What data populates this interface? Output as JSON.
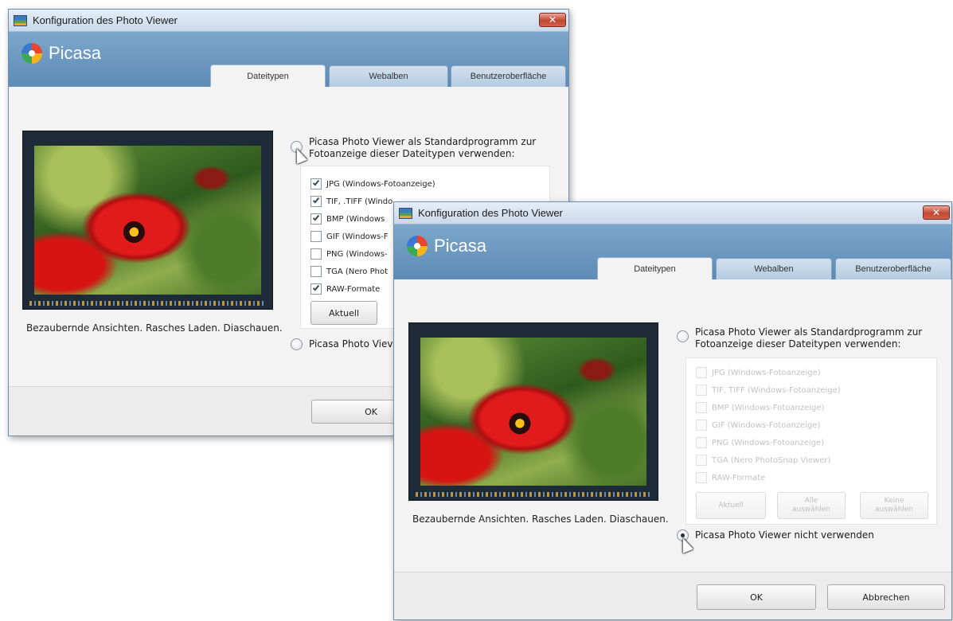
{
  "back_window": {
    "title": "Konfiguration des Photo Viewer",
    "close_glyph": "✕",
    "logo": "Picasa",
    "tabs": [
      "Dateitypen",
      "Webalben",
      "Benutzeroberfläche"
    ],
    "caption": "Bezaubernde Ansichten. Rasches Laden. Diaschauen.",
    "radio_default_line1": "Picasa Photo Viewer als Standardprogramm zur",
    "radio_default_line2": "Fotoanzeige dieser Dateitypen verwenden:",
    "file_types": [
      {
        "label": "JPG (Windows-Fotoanzeige)",
        "checked": true
      },
      {
        "label": "TIF, .TIFF (Windo",
        "checked": true
      },
      {
        "label": "BMP (Windows",
        "checked": true
      },
      {
        "label": "GIF (Windows-F",
        "checked": false
      },
      {
        "label": "PNG (Windows-",
        "checked": false
      },
      {
        "label": "TGA (Nero Phot",
        "checked": false
      },
      {
        "label": "RAW-Formate",
        "checked": true
      }
    ],
    "btn_current": "Aktuell",
    "radio_none": "Picasa Photo Viev",
    "ok": "OK"
  },
  "front_window": {
    "title": "Konfiguration des Photo Viewer",
    "close_glyph": "✕",
    "logo": "Picasa",
    "tabs": [
      "Dateitypen",
      "Webalben",
      "Benutzeroberfläche"
    ],
    "caption": "Bezaubernde Ansichten. Rasches Laden. Diaschauen.",
    "radio_default_line1": "Picasa Photo Viewer als Standardprogramm zur",
    "radio_default_line2": "Fotoanzeige dieser Dateitypen verwenden:",
    "file_types": [
      {
        "label": "JPG (Windows-Fotoanzeige)",
        "checked": false
      },
      {
        "label": "TIF, TIFF (Windows-Fotoanzeige)",
        "checked": false
      },
      {
        "label": "BMP (Windows-Fotoanzeige)",
        "checked": false
      },
      {
        "label": "GIF (Windows-Fotoanzeige)",
        "checked": false
      },
      {
        "label": "PNG (Windows-Fotoanzeige)",
        "checked": false
      },
      {
        "label": "TGA (Nero PhotoSnap Viewer)",
        "checked": false
      },
      {
        "label": "RAW-Formate",
        "checked": false
      }
    ],
    "btn_current": "Aktuell",
    "btn_select_all": "Alle auswählen",
    "btn_select_none": "Keine auswählen",
    "radio_none": "Picasa Photo Viewer nicht verwenden",
    "ok": "OK",
    "cancel": "Abbrechen"
  }
}
